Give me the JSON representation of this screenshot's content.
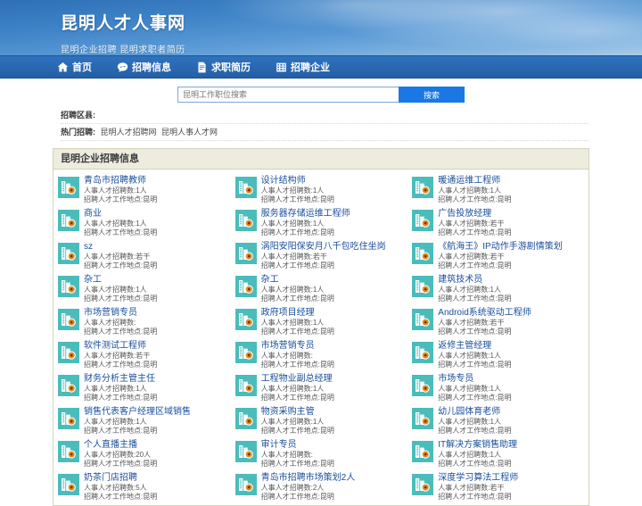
{
  "banner": {
    "title": "昆明人才人事网",
    "subtitle": "昆明企业招聘 昆明求职者简历"
  },
  "nav": {
    "items": [
      {
        "label": "首页",
        "icon": "home-icon"
      },
      {
        "label": "招聘信息",
        "icon": "chat-icon"
      },
      {
        "label": "求职简历",
        "icon": "document-icon"
      },
      {
        "label": "招聘企业",
        "icon": "building-icon"
      }
    ]
  },
  "search": {
    "placeholder": "昆明工作职位搜索",
    "value": "",
    "button_label": "搜索"
  },
  "filters": [
    {
      "label": "招聘区县:",
      "links": []
    },
    {
      "label": "热门招聘:",
      "links": [
        "昆明人才招聘网",
        "昆明人事人才网"
      ]
    }
  ],
  "panel": {
    "title": "昆明企业招聘信息",
    "meta_count_label": "人事人才招聘数:",
    "meta_place_label": "招聘人才工作地点:",
    "columns": [
      {
        "jobs": [
          {
            "title": "青岛市招聘教师",
            "count": "1人",
            "place": "昆明"
          },
          {
            "title": "商业",
            "count": "1人",
            "place": "昆明"
          },
          {
            "title": "sz",
            "count": "若干",
            "place": "昆明"
          },
          {
            "title": "杂工",
            "count": "1人",
            "place": "昆明"
          },
          {
            "title": "市场营销专员",
            "count": "",
            "place": "昆明"
          },
          {
            "title": "软件测试工程师",
            "count": "若干",
            "place": "昆明"
          },
          {
            "title": "财务分析主管主任",
            "count": "1人",
            "place": "昆明"
          },
          {
            "title": "销售代表客户经理区域销售",
            "count": "1人",
            "place": "昆明"
          },
          {
            "title": "个人直播主播",
            "count": "20人",
            "place": "昆明"
          },
          {
            "title": "奶茶门店招聘",
            "count": "5人",
            "place": "昆明"
          }
        ]
      },
      {
        "jobs": [
          {
            "title": "设计结构师",
            "count": "1人",
            "place": "昆明"
          },
          {
            "title": "服务器存储运维工程师",
            "count": "1人",
            "place": "昆明"
          },
          {
            "title": "涡阳安阳保安月八千包吃住坐岗",
            "count": "若干",
            "place": "昆明"
          },
          {
            "title": "杂工",
            "count": "1人",
            "place": "昆明"
          },
          {
            "title": "政府项目经理",
            "count": "1人",
            "place": "昆明"
          },
          {
            "title": "市场营销专员",
            "count": "",
            "place": "昆明"
          },
          {
            "title": "工程物业副总经理",
            "count": "1人",
            "place": "昆明"
          },
          {
            "title": "物资采购主管",
            "count": "1人",
            "place": "昆明"
          },
          {
            "title": "审计专员",
            "count": "",
            "place": "昆明"
          },
          {
            "title": "青岛市招聘市场策划2人",
            "count": "2人",
            "place": "昆明"
          }
        ]
      },
      {
        "jobs": [
          {
            "title": "暖通运维工程师",
            "count": "1人",
            "place": "昆明"
          },
          {
            "title": "广告投放经理",
            "count": "若干",
            "place": "昆明"
          },
          {
            "title": "《航海王》IP动作手游剧情策划",
            "count": "若干",
            "place": "昆明"
          },
          {
            "title": "建筑技术员",
            "count": "1人",
            "place": "昆明"
          },
          {
            "title": "Android系统驱动工程师",
            "count": "若干",
            "place": "昆明"
          },
          {
            "title": "返修主管经理",
            "count": "1人",
            "place": "昆明"
          },
          {
            "title": "市场专员",
            "count": "1人",
            "place": "昆明"
          },
          {
            "title": "幼儿园体育老师",
            "count": "1人",
            "place": "昆明"
          },
          {
            "title": "IT解决方案销售助理",
            "count": "1人",
            "place": "昆明"
          },
          {
            "title": "深度学习算法工程师",
            "count": "若干",
            "place": "昆明"
          }
        ]
      }
    ]
  },
  "colors": {
    "nav_blue": "#2f72bd",
    "search_blue": "#1a78e5",
    "panel_head": "#edecdd",
    "icon_teal": "#4bbcbc",
    "link_blue": "#1a4f9c"
  }
}
